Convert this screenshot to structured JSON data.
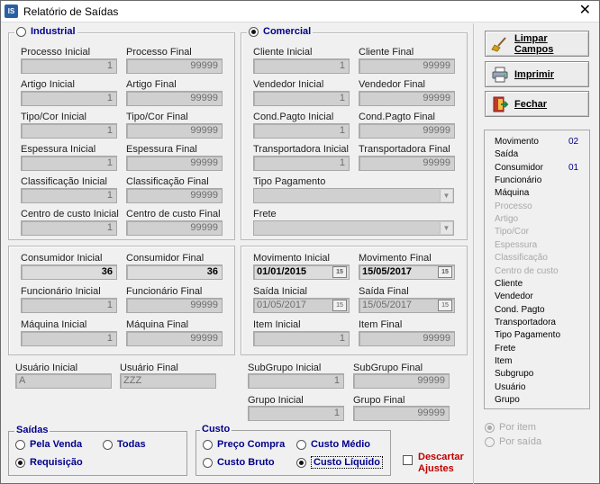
{
  "window": {
    "title": "Relatório de Saídas",
    "app_icon_text": "IS"
  },
  "industrial": {
    "label": "Industrial",
    "fields": [
      {
        "label": "Processo Inicial",
        "value": "1"
      },
      {
        "label": "Processo Final",
        "value": "99999"
      },
      {
        "label": "Artigo Inicial",
        "value": "1"
      },
      {
        "label": "Artigo Final",
        "value": "99999"
      },
      {
        "label": "Tipo/Cor Inicial",
        "value": "1"
      },
      {
        "label": "Tipo/Cor Final",
        "value": "99999"
      },
      {
        "label": "Espessura Inicial",
        "value": "1"
      },
      {
        "label": "Espessura Final",
        "value": "99999"
      },
      {
        "label": "Classificação Inicial",
        "value": "1"
      },
      {
        "label": "Classificação Final",
        "value": "99999"
      },
      {
        "label": "Centro de custo Inicial",
        "value": "1"
      },
      {
        "label": "Centro de custo Final",
        "value": "99999"
      }
    ]
  },
  "comercial": {
    "label": "Comercial",
    "fields": [
      {
        "label": "Cliente Inicial",
        "value": "1"
      },
      {
        "label": "Cliente Final",
        "value": "99999"
      },
      {
        "label": "Vendedor Inicial",
        "value": "1"
      },
      {
        "label": "Vendedor Final",
        "value": "99999"
      },
      {
        "label": "Cond.Pagto Inicial",
        "value": "1"
      },
      {
        "label": "Cond.Pagto Final",
        "value": "99999"
      },
      {
        "label": "Transportadora Inicial",
        "value": "1"
      },
      {
        "label": "Transportadora Final",
        "value": "99999"
      }
    ],
    "tipo_pagamento": {
      "label": "Tipo Pagamento",
      "value": ""
    },
    "frete": {
      "label": "Frete",
      "value": ""
    }
  },
  "consumidor": {
    "fields": [
      {
        "label": "Consumidor Inicial",
        "value": "36"
      },
      {
        "label": "Consumidor Final",
        "value": "36"
      },
      {
        "label": "Funcionário Inicial",
        "value": "1"
      },
      {
        "label": "Funcionário Final",
        "value": "99999"
      },
      {
        "label": "Máquina Inicial",
        "value": "1"
      },
      {
        "label": "Máquina Final",
        "value": "99999"
      }
    ]
  },
  "movimento": {
    "mov_ini": {
      "label": "Movimento Inicial",
      "value": "01/01/2015"
    },
    "mov_fim": {
      "label": "Movimento Final",
      "value": "15/05/2017"
    },
    "saida_ini": {
      "label": "Saída Inicial",
      "value": "01/05/2017"
    },
    "saida_fim": {
      "label": "Saída Final",
      "value": "15/05/2017"
    },
    "item_ini": {
      "label": "Item Inicial",
      "value": "1"
    },
    "item_fim": {
      "label": "Item Final",
      "value": "99999"
    },
    "calendar_icon_text": "15"
  },
  "usuario": {
    "ini": {
      "label": "Usuário Inicial",
      "value": "A"
    },
    "fim": {
      "label": "Usuário Final",
      "value": "ZZZ"
    }
  },
  "subgrupo": {
    "ini": {
      "label": "SubGrupo Inicial",
      "value": "1"
    },
    "fim": {
      "label": "SubGrupo Final",
      "value": "99999"
    }
  },
  "grupo": {
    "ini": {
      "label": "Grupo Inicial",
      "value": "1"
    },
    "fim": {
      "label": "Grupo Final",
      "value": "99999"
    }
  },
  "saidas": {
    "label": "Saídas",
    "pela_venda": "Pela Venda",
    "todas": "Todas",
    "requisicao": "Requisição"
  },
  "custo": {
    "label": "Custo",
    "preco_compra": "Preço Compra",
    "custo_medio": "Custo Médio",
    "custo_bruto": "Custo Bruto",
    "custo_liquido": "Custo Líquido"
  },
  "descartar": {
    "line1": "Descartar",
    "line2": "Ajustes"
  },
  "buttons": {
    "limpar": "Limpar Campos",
    "imprimir": "Imprimir",
    "fechar": "Fechar"
  },
  "ordering": {
    "items": [
      {
        "label": "Movimento",
        "num": "02"
      },
      {
        "label": "Saída",
        "num": ""
      },
      {
        "label": "Consumidor",
        "num": "01"
      },
      {
        "label": "Funcionário",
        "num": ""
      },
      {
        "label": "Máquina",
        "num": ""
      },
      {
        "label": "Processo",
        "num": ""
      },
      {
        "label": "Artigo",
        "num": ""
      },
      {
        "label": "Tipo/Cor",
        "num": ""
      },
      {
        "label": "Espessura",
        "num": ""
      },
      {
        "label": "Classificação",
        "num": ""
      },
      {
        "label": "Centro de custo",
        "num": ""
      },
      {
        "label": "Cliente",
        "num": ""
      },
      {
        "label": "Vendedor",
        "num": ""
      },
      {
        "label": "Cond. Pagto",
        "num": ""
      },
      {
        "label": "Transportadora",
        "num": ""
      },
      {
        "label": "Tipo Pagamento",
        "num": ""
      },
      {
        "label": "Frete",
        "num": ""
      },
      {
        "label": "Item",
        "num": ""
      },
      {
        "label": "Subgrupo",
        "num": ""
      },
      {
        "label": "Usuário",
        "num": ""
      },
      {
        "label": "Grupo",
        "num": ""
      }
    ]
  },
  "por_item": "Por item",
  "por_saida": "Por saída"
}
